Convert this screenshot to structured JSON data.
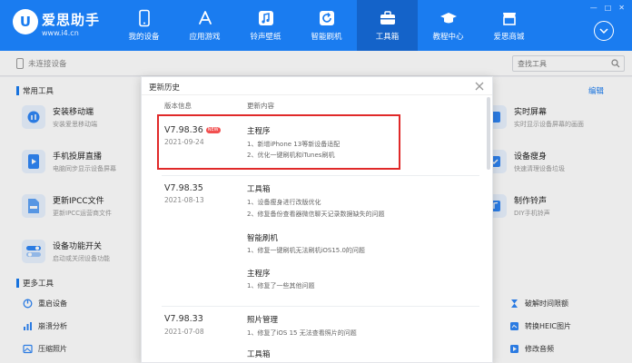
{
  "brand": {
    "logo_char": "U",
    "name": "爱思助手",
    "url": "www.i4.cn"
  },
  "window_controls": [
    "—",
    "□",
    "✕"
  ],
  "nav": [
    {
      "label": "我的设备",
      "icon": "phone-icon"
    },
    {
      "label": "应用游戏",
      "icon": "app-store-icon"
    },
    {
      "label": "铃声壁纸",
      "icon": "music-icon"
    },
    {
      "label": "智能刷机",
      "icon": "refresh-icon"
    },
    {
      "label": "工具箱",
      "icon": "toolbox-icon",
      "active": true
    },
    {
      "label": "教程中心",
      "icon": "graduation-cap-icon"
    },
    {
      "label": "爱思商城",
      "icon": "store-icon"
    }
  ],
  "subbar": {
    "device_status": "未连接设备",
    "search_placeholder": "查找工具"
  },
  "sections": {
    "common": "常用工具",
    "more": "更多工具",
    "edit": "编辑"
  },
  "tools_left": [
    {
      "title": "安装移动端",
      "desc": "安装爱思移动端"
    },
    {
      "title": "手机投屏直播",
      "desc": "电脑同步显示设备屏幕"
    },
    {
      "title": "更新IPCC文件",
      "desc": "更新IPCC运营商文件"
    },
    {
      "title": "设备功能开关",
      "desc": "启动或关闭设备功能"
    }
  ],
  "tools_right": [
    {
      "title": "实时屏幕",
      "desc": "实时显示设备屏幕的画面"
    },
    {
      "title": "设备瘦身",
      "desc": "快速清理设备垃圾"
    },
    {
      "title": "制作铃声",
      "desc": "DIY手机铃声"
    }
  ],
  "more_left": [
    "重启设备",
    "崩溃分析",
    "压缩照片"
  ],
  "more_right": [
    "破解时间限额",
    "转换HEIC图片",
    "修改音频"
  ],
  "modal": {
    "title": "更新历史",
    "col_version": "版本信息",
    "col_content": "更新内容",
    "new_badge": "NEW",
    "releases": [
      {
        "version": "V7.98.36",
        "date": "2021-09-24",
        "groups": [
          {
            "category": "主程序",
            "items": [
              "1、新增iPhone 13等新设备适配",
              "2、优化一键刷机和iTunes刷机"
            ]
          }
        ]
      },
      {
        "version": "V7.98.35",
        "date": "2021-08-13",
        "groups": [
          {
            "category": "工具箱",
            "items": [
              "1、设备瘦身进行改版优化",
              "2、修复备份查看器微信聊天记录数据缺失的问题"
            ]
          },
          {
            "category": "智能刷机",
            "items": [
              "1、修复一键刷机无法刷机iOS15.0的问题"
            ]
          },
          {
            "category": "主程序",
            "items": [
              "1、修复了一些其他问题"
            ]
          }
        ]
      },
      {
        "version": "V7.98.33",
        "date": "2021-07-08",
        "groups": [
          {
            "category": "照片管理",
            "items": [
              "1、修复了iOS 15 无法查看照片的问题"
            ]
          },
          {
            "category": "工具箱",
            "items": []
          }
        ]
      }
    ]
  }
}
